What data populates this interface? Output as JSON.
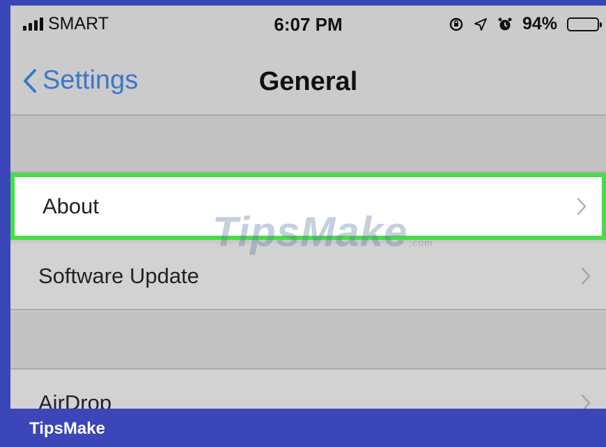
{
  "status_bar": {
    "carrier": "SMART",
    "time": "6:07 PM",
    "battery": "94%",
    "battery_level": 0.94,
    "icons": [
      "signal-icon",
      "orientation-lock-icon",
      "location-icon",
      "alarm-icon",
      "battery-icon"
    ]
  },
  "nav": {
    "back_label": "Settings",
    "title": "General"
  },
  "rows": {
    "about": "About",
    "software_update": "Software Update",
    "airdrop": "AirDrop"
  },
  "watermark": {
    "text": "TipsMake",
    "suffix": ".com"
  },
  "brand": "TipsMake",
  "colors": {
    "frame": "#3b46b8",
    "highlight": "#43e041",
    "link": "#3a78c8"
  }
}
